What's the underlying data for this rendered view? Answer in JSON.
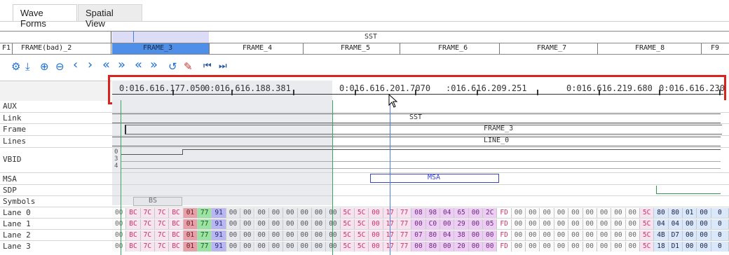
{
  "tabs": [
    {
      "label": "Wave Forms"
    },
    {
      "label": "Spatial View"
    }
  ],
  "top": {
    "sst_label": "SST",
    "frames": [
      {
        "label": "F1"
      },
      {
        "label": "FRAME(bad)_2"
      },
      {
        "label": "FRAME_3"
      },
      {
        "label": "FRAME_4"
      },
      {
        "label": "FRAME_5"
      },
      {
        "label": "FRAME_6"
      },
      {
        "label": "FRAME_7"
      },
      {
        "label": "FRAME_8"
      },
      {
        "label": "F9"
      }
    ]
  },
  "toolbar": {
    "icons": [
      "settings-icon",
      "download-icon",
      "zoom-in-icon",
      "zoom-out-icon",
      "chevron-left-icon",
      "chevron-right-icon",
      "double-chevron-left-icon",
      "double-chevron-right-icon",
      "fast-back-icon",
      "fast-forward-icon",
      "history-icon",
      "clear-icon",
      "skip-start-icon",
      "skip-end-icon"
    ],
    "glyphs": [
      "⚙",
      "⤓",
      "⊕",
      "⊖",
      "‹",
      "›",
      "«",
      "»",
      "«",
      "»",
      "↺",
      "✎",
      "⏮",
      "⏭"
    ]
  },
  "timeline": {
    "labels": [
      "0:016.616.177.050",
      "0:016.616.188.381",
      "0:016.616.201.7070",
      ":016.616.209.251",
      "0:016.616.219.680",
      "0:016.616.230"
    ],
    "highlight_color": "#d9231d"
  },
  "signals": [
    {
      "name": "AUX"
    },
    {
      "name": "Link"
    },
    {
      "name": "Frame"
    },
    {
      "name": "Lines"
    },
    {
      "name": "VBID"
    },
    {
      "name": "MSA"
    },
    {
      "name": "SDP"
    },
    {
      "name": "Symbols"
    },
    {
      "name": "Lane 0"
    },
    {
      "name": "Lane 1"
    },
    {
      "name": "Lane 2"
    },
    {
      "name": "Lane 3"
    }
  ],
  "waves": {
    "link_value": "SST",
    "frame_value": "FRAME_3",
    "lines_value": "LINE_0",
    "vbid_values": [
      "0",
      "3",
      "4"
    ],
    "msa_value": "MSA",
    "symbols_value": "BS"
  },
  "lanes": [
    [
      "00",
      "BC",
      "7C",
      "7C",
      "BC",
      "01",
      "77",
      "91",
      "00",
      "00",
      "00",
      "00",
      "00",
      "00",
      "00",
      "00",
      "5C",
      "5C",
      "00",
      "17",
      "77",
      "08",
      "98",
      "04",
      "65",
      "00",
      "2C",
      "FD",
      "00",
      "00",
      "00",
      "00",
      "00",
      "00",
      "00",
      "00",
      "00",
      "5C",
      "80",
      "80",
      "01",
      "00",
      "0"
    ],
    [
      "00",
      "BC",
      "7C",
      "7C",
      "BC",
      "01",
      "77",
      "91",
      "00",
      "00",
      "00",
      "00",
      "00",
      "00",
      "00",
      "00",
      "5C",
      "5C",
      "00",
      "17",
      "77",
      "00",
      "C0",
      "00",
      "29",
      "00",
      "05",
      "FD",
      "00",
      "00",
      "00",
      "00",
      "00",
      "00",
      "00",
      "00",
      "00",
      "5C",
      "04",
      "04",
      "00",
      "00",
      "0"
    ],
    [
      "00",
      "BC",
      "7C",
      "7C",
      "BC",
      "01",
      "77",
      "91",
      "00",
      "00",
      "00",
      "00",
      "00",
      "00",
      "00",
      "00",
      "5C",
      "5C",
      "00",
      "17",
      "77",
      "07",
      "80",
      "04",
      "38",
      "00",
      "00",
      "FD",
      "00",
      "00",
      "00",
      "00",
      "00",
      "00",
      "00",
      "00",
      "00",
      "5C",
      "4B",
      "D7",
      "00",
      "00",
      "0"
    ],
    [
      "00",
      "BC",
      "7C",
      "7C",
      "BC",
      "01",
      "77",
      "91",
      "00",
      "00",
      "00",
      "00",
      "00",
      "00",
      "00",
      "00",
      "5C",
      "5C",
      "00",
      "17",
      "77",
      "00",
      "80",
      "00",
      "20",
      "00",
      "00",
      "FD",
      "00",
      "00",
      "00",
      "00",
      "00",
      "00",
      "00",
      "00",
      "00",
      "5C",
      "18",
      "D1",
      "00",
      "00",
      "0"
    ]
  ],
  "colors": {
    "accent": "#1a6fd1",
    "frame_selected": "#4f8fe8",
    "highlight_red": "#d9231d",
    "cursor": "#4a7fe0"
  }
}
